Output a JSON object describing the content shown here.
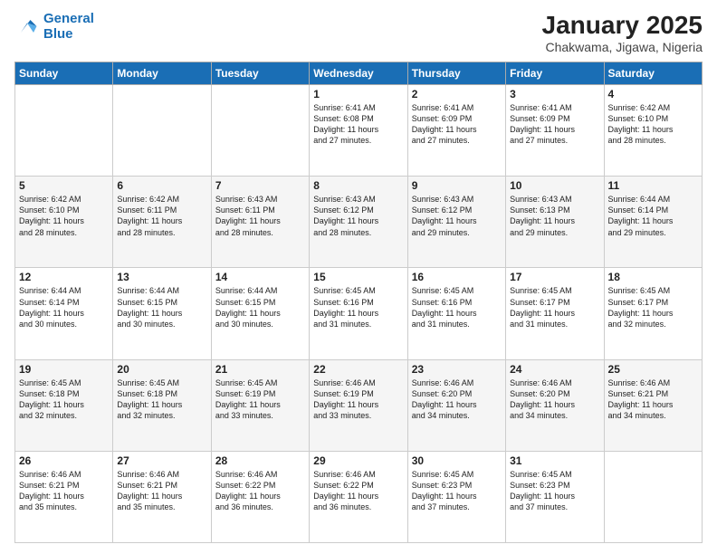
{
  "logo": {
    "line1": "General",
    "line2": "Blue"
  },
  "title": "January 2025",
  "location": "Chakwama, Jigawa, Nigeria",
  "weekdays": [
    "Sunday",
    "Monday",
    "Tuesday",
    "Wednesday",
    "Thursday",
    "Friday",
    "Saturday"
  ],
  "weeks": [
    [
      {
        "day": null,
        "info": null
      },
      {
        "day": null,
        "info": null
      },
      {
        "day": null,
        "info": null
      },
      {
        "day": "1",
        "info": "Sunrise: 6:41 AM\nSunset: 6:08 PM\nDaylight: 11 hours\nand 27 minutes."
      },
      {
        "day": "2",
        "info": "Sunrise: 6:41 AM\nSunset: 6:09 PM\nDaylight: 11 hours\nand 27 minutes."
      },
      {
        "day": "3",
        "info": "Sunrise: 6:41 AM\nSunset: 6:09 PM\nDaylight: 11 hours\nand 27 minutes."
      },
      {
        "day": "4",
        "info": "Sunrise: 6:42 AM\nSunset: 6:10 PM\nDaylight: 11 hours\nand 28 minutes."
      }
    ],
    [
      {
        "day": "5",
        "info": "Sunrise: 6:42 AM\nSunset: 6:10 PM\nDaylight: 11 hours\nand 28 minutes."
      },
      {
        "day": "6",
        "info": "Sunrise: 6:42 AM\nSunset: 6:11 PM\nDaylight: 11 hours\nand 28 minutes."
      },
      {
        "day": "7",
        "info": "Sunrise: 6:43 AM\nSunset: 6:11 PM\nDaylight: 11 hours\nand 28 minutes."
      },
      {
        "day": "8",
        "info": "Sunrise: 6:43 AM\nSunset: 6:12 PM\nDaylight: 11 hours\nand 28 minutes."
      },
      {
        "day": "9",
        "info": "Sunrise: 6:43 AM\nSunset: 6:12 PM\nDaylight: 11 hours\nand 29 minutes."
      },
      {
        "day": "10",
        "info": "Sunrise: 6:43 AM\nSunset: 6:13 PM\nDaylight: 11 hours\nand 29 minutes."
      },
      {
        "day": "11",
        "info": "Sunrise: 6:44 AM\nSunset: 6:14 PM\nDaylight: 11 hours\nand 29 minutes."
      }
    ],
    [
      {
        "day": "12",
        "info": "Sunrise: 6:44 AM\nSunset: 6:14 PM\nDaylight: 11 hours\nand 30 minutes."
      },
      {
        "day": "13",
        "info": "Sunrise: 6:44 AM\nSunset: 6:15 PM\nDaylight: 11 hours\nand 30 minutes."
      },
      {
        "day": "14",
        "info": "Sunrise: 6:44 AM\nSunset: 6:15 PM\nDaylight: 11 hours\nand 30 minutes."
      },
      {
        "day": "15",
        "info": "Sunrise: 6:45 AM\nSunset: 6:16 PM\nDaylight: 11 hours\nand 31 minutes."
      },
      {
        "day": "16",
        "info": "Sunrise: 6:45 AM\nSunset: 6:16 PM\nDaylight: 11 hours\nand 31 minutes."
      },
      {
        "day": "17",
        "info": "Sunrise: 6:45 AM\nSunset: 6:17 PM\nDaylight: 11 hours\nand 31 minutes."
      },
      {
        "day": "18",
        "info": "Sunrise: 6:45 AM\nSunset: 6:17 PM\nDaylight: 11 hours\nand 32 minutes."
      }
    ],
    [
      {
        "day": "19",
        "info": "Sunrise: 6:45 AM\nSunset: 6:18 PM\nDaylight: 11 hours\nand 32 minutes."
      },
      {
        "day": "20",
        "info": "Sunrise: 6:45 AM\nSunset: 6:18 PM\nDaylight: 11 hours\nand 32 minutes."
      },
      {
        "day": "21",
        "info": "Sunrise: 6:45 AM\nSunset: 6:19 PM\nDaylight: 11 hours\nand 33 minutes."
      },
      {
        "day": "22",
        "info": "Sunrise: 6:46 AM\nSunset: 6:19 PM\nDaylight: 11 hours\nand 33 minutes."
      },
      {
        "day": "23",
        "info": "Sunrise: 6:46 AM\nSunset: 6:20 PM\nDaylight: 11 hours\nand 34 minutes."
      },
      {
        "day": "24",
        "info": "Sunrise: 6:46 AM\nSunset: 6:20 PM\nDaylight: 11 hours\nand 34 minutes."
      },
      {
        "day": "25",
        "info": "Sunrise: 6:46 AM\nSunset: 6:21 PM\nDaylight: 11 hours\nand 34 minutes."
      }
    ],
    [
      {
        "day": "26",
        "info": "Sunrise: 6:46 AM\nSunset: 6:21 PM\nDaylight: 11 hours\nand 35 minutes."
      },
      {
        "day": "27",
        "info": "Sunrise: 6:46 AM\nSunset: 6:21 PM\nDaylight: 11 hours\nand 35 minutes."
      },
      {
        "day": "28",
        "info": "Sunrise: 6:46 AM\nSunset: 6:22 PM\nDaylight: 11 hours\nand 36 minutes."
      },
      {
        "day": "29",
        "info": "Sunrise: 6:46 AM\nSunset: 6:22 PM\nDaylight: 11 hours\nand 36 minutes."
      },
      {
        "day": "30",
        "info": "Sunrise: 6:45 AM\nSunset: 6:23 PM\nDaylight: 11 hours\nand 37 minutes."
      },
      {
        "day": "31",
        "info": "Sunrise: 6:45 AM\nSunset: 6:23 PM\nDaylight: 11 hours\nand 37 minutes."
      },
      {
        "day": null,
        "info": null
      }
    ]
  ]
}
